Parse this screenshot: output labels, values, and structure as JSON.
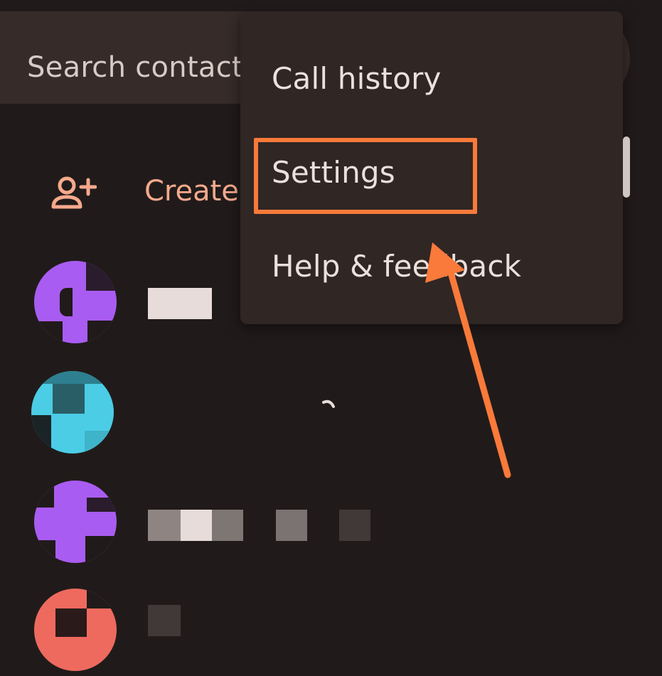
{
  "search": {
    "placeholder": "Search contact"
  },
  "create": {
    "label": "Create",
    "icon": "add-person-icon"
  },
  "overflow_menu": {
    "items": [
      {
        "label": "Call history"
      },
      {
        "label": "Settings",
        "highlighted": true
      },
      {
        "label": "Help & feedback"
      }
    ]
  },
  "colors": {
    "background": "#201b1a",
    "search_bar": "#362b28",
    "menu": "#302624",
    "accent_text": "#f6a98c",
    "annotation": "#f97a3a",
    "avatar_purple": "#a95cf1",
    "avatar_cyan": "#4bcde6",
    "avatar_coral": "#ee6a5f"
  },
  "contacts": [
    {
      "avatar_color": "#a95cf1"
    },
    {
      "avatar_color": "#4bcde6"
    },
    {
      "avatar_color": "#a95cf1"
    },
    {
      "avatar_color": "#ee6a5f"
    }
  ]
}
